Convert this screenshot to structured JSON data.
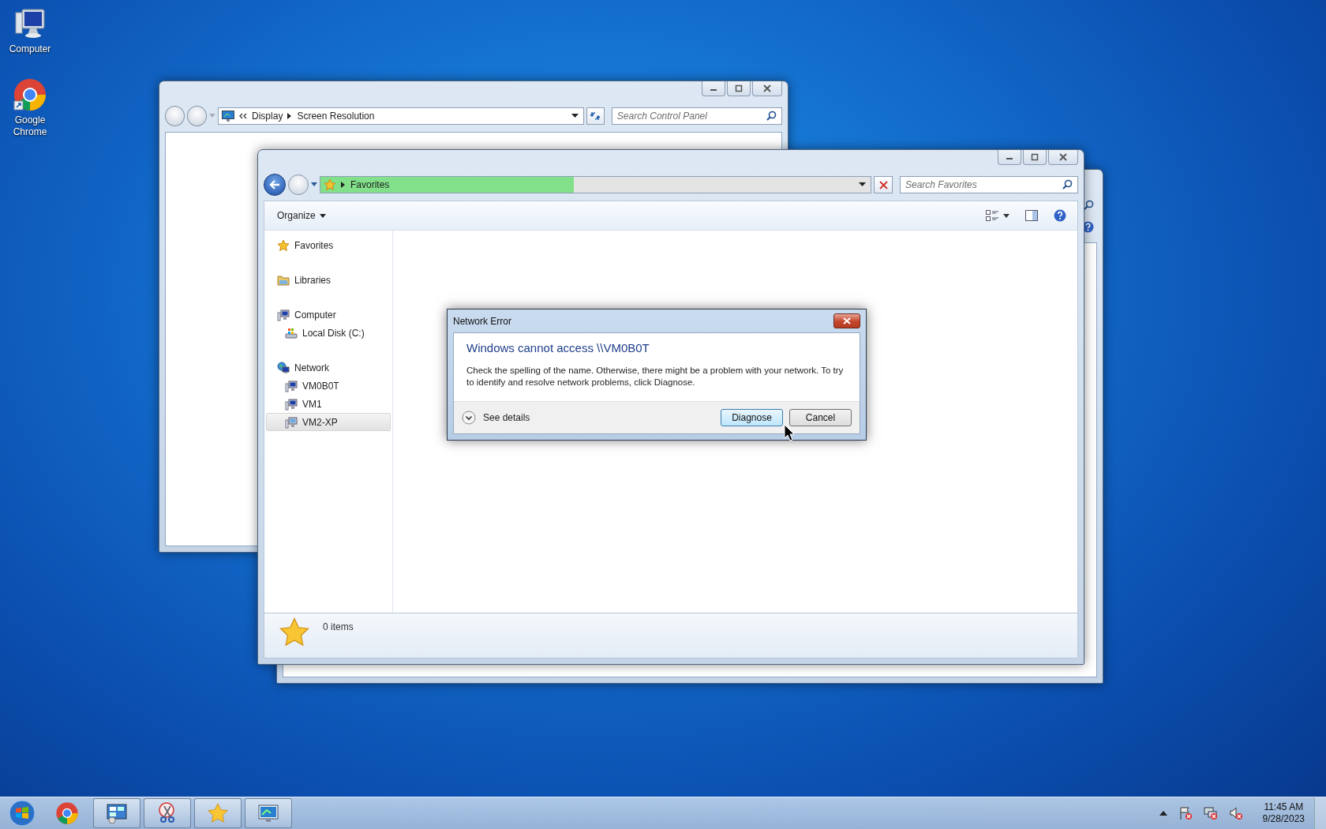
{
  "desktop_icons": [
    {
      "label": "Computer",
      "kind": "computer"
    },
    {
      "label": "Google Chrome",
      "kind": "chrome"
    }
  ],
  "control_panel_window": {
    "breadcrumb": [
      "Display",
      "Screen Resolution"
    ],
    "search": {
      "placeholder": "Search Control Panel"
    }
  },
  "explorer_window": {
    "address": {
      "location": "Favorites",
      "level": 0.46
    },
    "search": {
      "placeholder": "Search Favorites"
    },
    "toolbar": {
      "organize": "Organize"
    },
    "sidebar": {
      "items": [
        {
          "label": "Favorites",
          "kind": "favorites",
          "selected": false
        },
        {
          "label": "Libraries",
          "kind": "libraries",
          "selected": false
        },
        {
          "label": "Computer",
          "kind": "computer",
          "selected": false,
          "children": [
            {
              "label": "Local Disk (C:)",
              "kind": "drive",
              "selected": false
            }
          ]
        },
        {
          "label": "Network",
          "kind": "network",
          "selected": false,
          "children": [
            {
              "label": "VM0B0T",
              "kind": "computer",
              "selected": false
            },
            {
              "label": "VM1",
              "kind": "computer",
              "selected": false
            },
            {
              "label": "VM2-XP",
              "kind": "xp-computer",
              "selected": true
            }
          ]
        }
      ]
    },
    "status_bar": {
      "count": "0 items"
    }
  },
  "dialog": {
    "title": "Network Error",
    "heading": "Windows cannot access \\\\VM0B0T",
    "message": "Check the spelling of the name. Otherwise, there might be a problem with your network. To try to identify and resolve network problems, click Diagnose.",
    "details_toggle": "See details",
    "buttons": [
      {
        "label": "Diagnose",
        "default": true
      },
      {
        "label": "Cancel",
        "default": false
      }
    ]
  },
  "taskbar": {
    "apps": [
      {
        "kind": "chrome"
      },
      {
        "kind": "control-panel"
      },
      {
        "kind": "scissors"
      },
      {
        "kind": "favorites"
      },
      {
        "kind": "display"
      }
    ],
    "clock": {
      "time": "11:45 AM",
      "date": "9/28/2023"
    }
  }
}
